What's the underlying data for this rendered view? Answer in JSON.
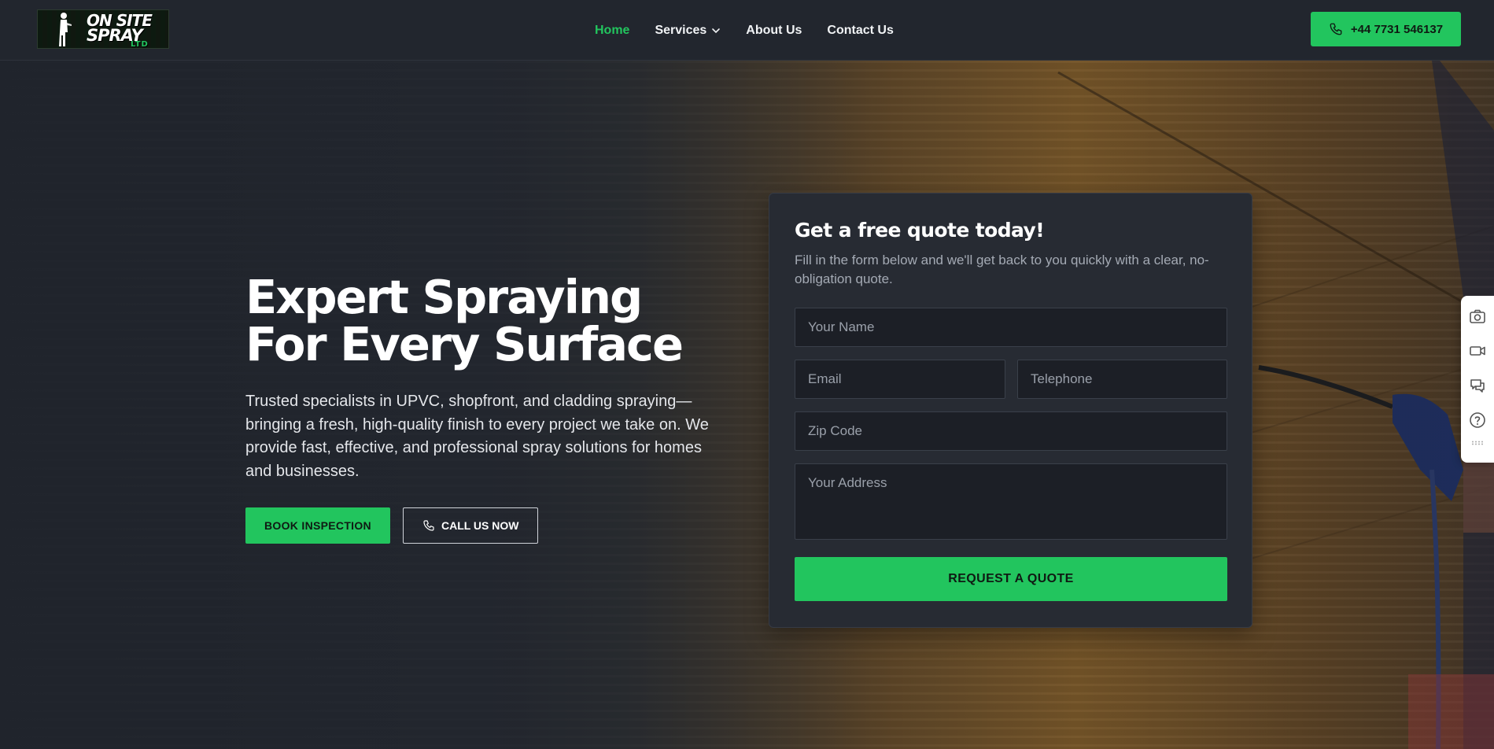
{
  "header": {
    "logo": {
      "line1": "ON SITE",
      "line2": "SPRAY",
      "line3": "LTD"
    },
    "nav": [
      {
        "label": "Home",
        "active": true
      },
      {
        "label": "Services",
        "has_dropdown": true
      },
      {
        "label": "About Us"
      },
      {
        "label": "Contact Us"
      }
    ],
    "phone_label": "+44 7731 546137"
  },
  "hero": {
    "title_line1": "Expert Spraying",
    "title_line2": "For Every Surface",
    "subtitle": "Trusted specialists in UPVC, shopfront, and cladding spraying—bringing a fresh, high-quality finish to every project we take on. We provide fast, effective, and professional spray solutions for homes and businesses.",
    "book_label": "BOOK INSPECTION",
    "call_label": "CALL US NOW"
  },
  "quote_form": {
    "title": "Get a free quote today!",
    "description": "Fill in the form below and we'll get back to you quickly with a clear, no-obligation quote.",
    "name_placeholder": "Your Name",
    "email_placeholder": "Email",
    "telephone_placeholder": "Telephone",
    "zip_placeholder": "Zip Code",
    "address_placeholder": "Your Address",
    "submit_label": "REQUEST A QUOTE"
  },
  "side_widget": {
    "icons": [
      "camera-icon",
      "video-icon",
      "chat-icon",
      "help-icon",
      "drag-handle-icon"
    ]
  },
  "colors": {
    "accent": "#22c55e",
    "header_bg": "#22262e",
    "card_bg": "#272b33"
  }
}
